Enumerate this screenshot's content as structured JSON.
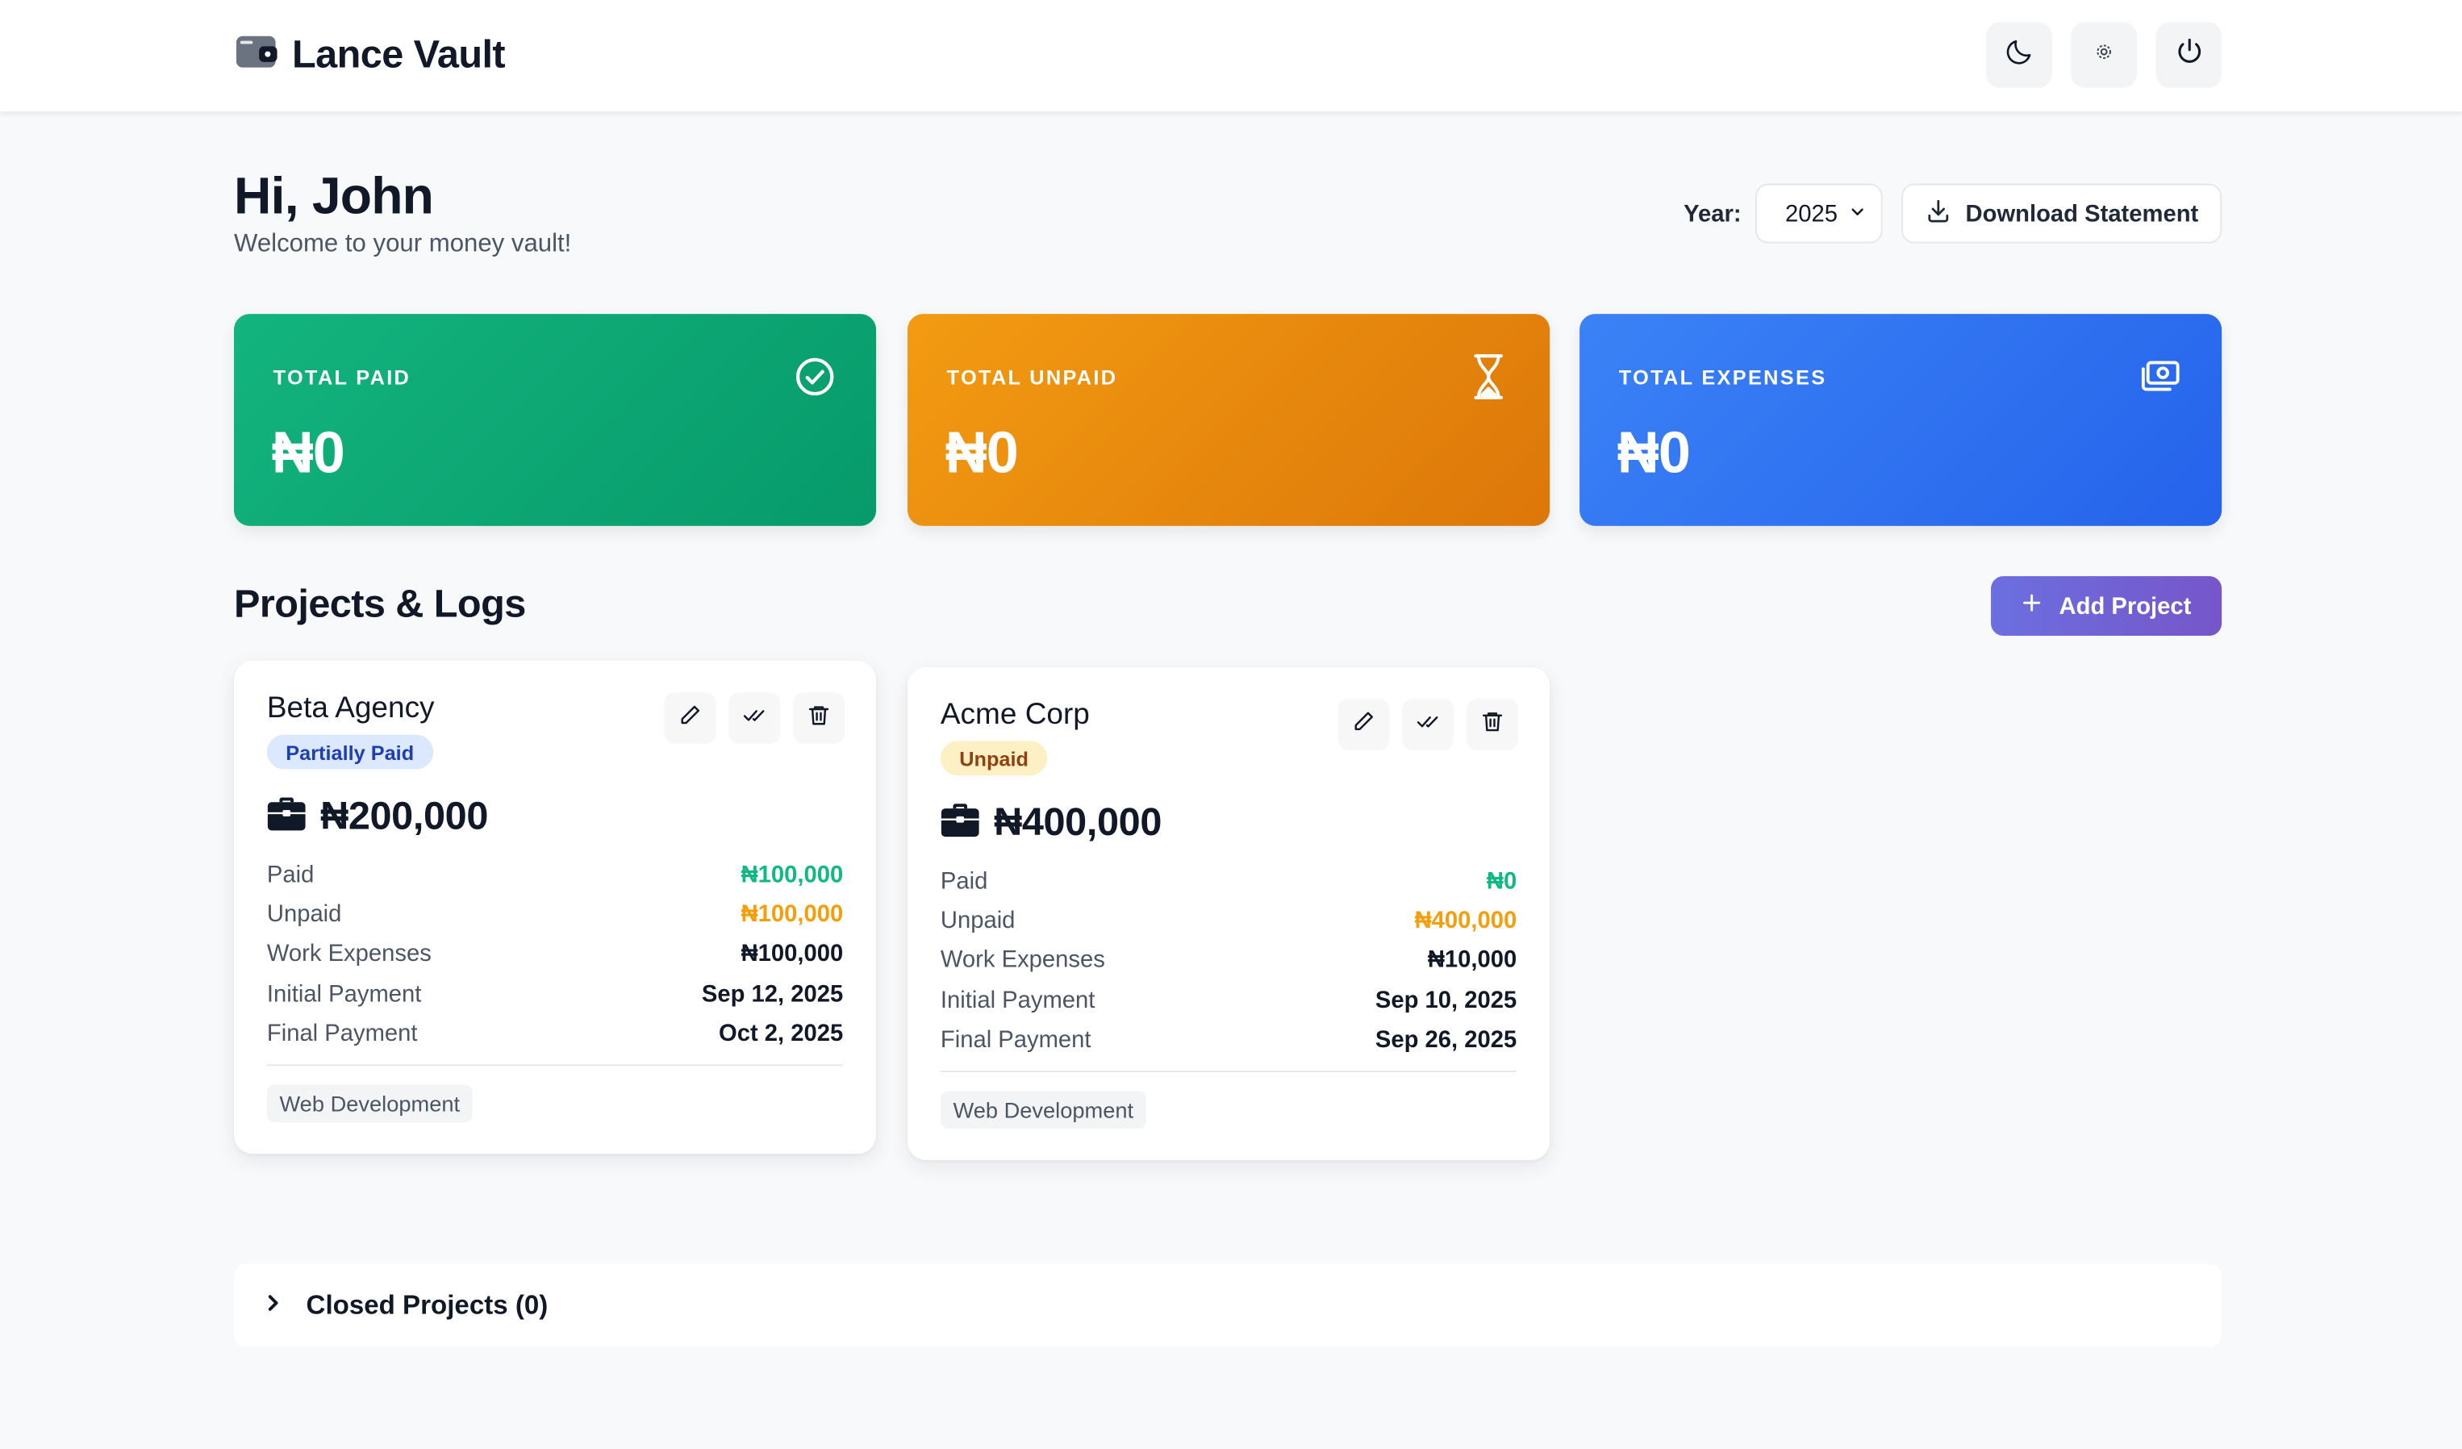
{
  "app": {
    "title": "Lance Vault"
  },
  "header": {
    "icons": [
      "wallet-icon",
      "moon-icon",
      "settings-icon",
      "power-icon"
    ]
  },
  "greeting": {
    "title": "Hi, John",
    "subtitle": "Welcome to your money vault!"
  },
  "controls": {
    "year_label": "Year:",
    "year_value": "2025",
    "download_label": "Download Statement"
  },
  "summary": [
    {
      "label": "TOTAL PAID",
      "value": "₦0",
      "icon": "check-circle-icon",
      "color": "#10b981"
    },
    {
      "label": "TOTAL UNPAID",
      "value": "₦0",
      "icon": "hourglass-icon",
      "color": "#f59e0b"
    },
    {
      "label": "TOTAL EXPENSES",
      "value": "₦0",
      "icon": "money-icon",
      "color": "#3b82f6"
    }
  ],
  "projects_section": {
    "title": "Projects & Logs",
    "add_label": "Add Project"
  },
  "projects": [
    {
      "name": "Beta Agency",
      "status": "Partially Paid",
      "total": "₦200,000",
      "rows": [
        {
          "label": "Paid",
          "value": "₦100,000"
        },
        {
          "label": "Unpaid",
          "value": "₦100,000"
        },
        {
          "label": "Work Expenses",
          "value": "₦100,000"
        },
        {
          "label": "Initial Payment",
          "value": "Sep 12, 2025"
        },
        {
          "label": "Final Payment",
          "value": "Oct 2, 2025"
        }
      ],
      "tag": "Web Development"
    },
    {
      "name": "Acme Corp",
      "status": "Unpaid",
      "total": "₦400,000",
      "rows": [
        {
          "label": "Paid",
          "value": "₦0"
        },
        {
          "label": "Unpaid",
          "value": "₦400,000"
        },
        {
          "label": "Work Expenses",
          "value": "₦10,000"
        },
        {
          "label": "Initial Payment",
          "value": "Sep 10, 2025"
        },
        {
          "label": "Final Payment",
          "value": "Sep 26, 2025"
        }
      ],
      "tag": "Web Development"
    }
  ],
  "closed": {
    "label": "Closed Projects (0)"
  }
}
